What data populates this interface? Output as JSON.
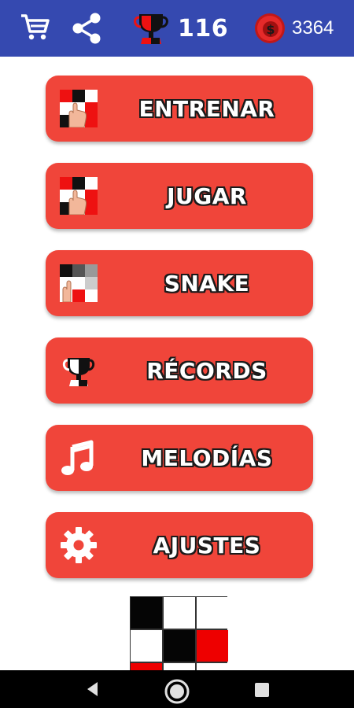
{
  "header": {
    "trophy_count": "116",
    "coins": "3364"
  },
  "menu": [
    {
      "label": "ENTRENAR"
    },
    {
      "label": "JUGAR"
    },
    {
      "label": "SNAKE"
    },
    {
      "label": "RÉCORDS"
    },
    {
      "label": "MELODÍAS"
    },
    {
      "label": "AJUSTES"
    }
  ],
  "colors": {
    "topbar": "#3549b0",
    "button": "#f0453a",
    "accent_red": "#ee0000"
  },
  "icons": {
    "topbar": [
      "cart-icon",
      "share-icon",
      "trophy-icon",
      "coin-icon"
    ],
    "navbar": [
      "back-icon",
      "home-icon",
      "recents-icon"
    ]
  },
  "preview_grid": [
    [
      "black",
      "white",
      "white"
    ],
    [
      "white",
      "black",
      "red"
    ],
    [
      "red",
      "white",
      "white"
    ]
  ]
}
